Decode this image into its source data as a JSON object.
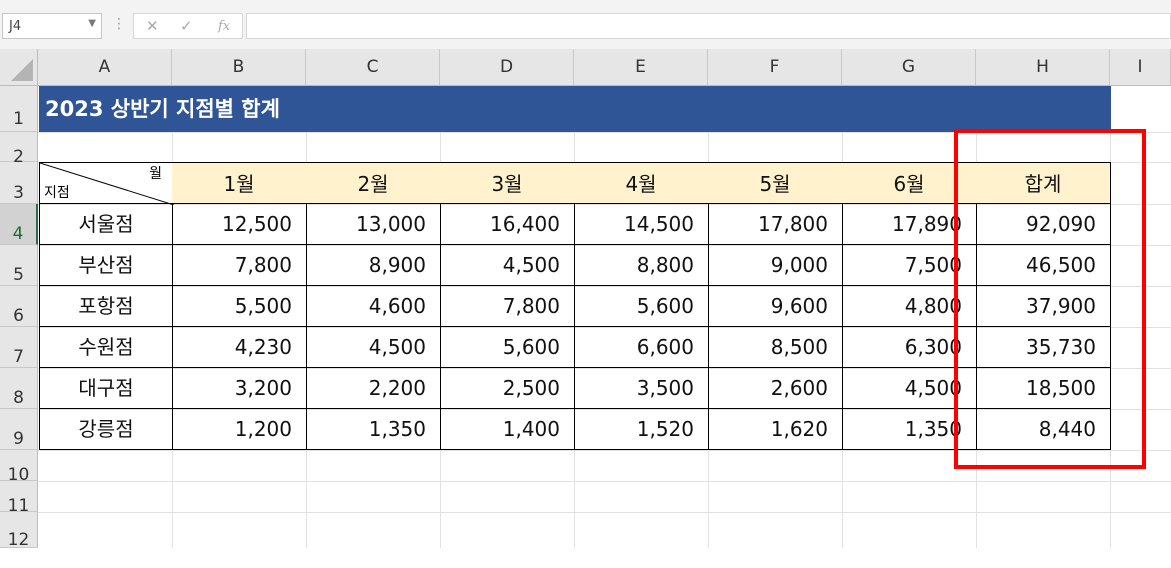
{
  "formula_bar": {
    "name_box": "J4",
    "icons": [
      "cancel-icon",
      "enter-icon",
      "function-icon"
    ],
    "formula": ""
  },
  "columns": [
    "A",
    "B",
    "C",
    "D",
    "E",
    "F",
    "G",
    "H",
    "I"
  ],
  "rows": [
    "1",
    "2",
    "3",
    "4",
    "5",
    "6",
    "7",
    "8",
    "9",
    "10",
    "11",
    "12"
  ],
  "selected_row": "4",
  "sheet": {
    "title": "2023 상반기 지점별 합계",
    "title_color": "#2f5597",
    "header_fill": "#fff2cc",
    "diag_month": "월",
    "diag_branch": "지점",
    "headers": [
      "1월",
      "2월",
      "3월",
      "4월",
      "5월",
      "6월",
      "합계"
    ],
    "data": [
      {
        "branch": "서울점",
        "values": [
          "12,500",
          "13,000",
          "16,400",
          "14,500",
          "17,800",
          "17,890",
          "92,090"
        ]
      },
      {
        "branch": "부산점",
        "values": [
          "7,800",
          "8,900",
          "4,500",
          "8,800",
          "9,000",
          "7,500",
          "46,500"
        ]
      },
      {
        "branch": "포항점",
        "values": [
          "5,500",
          "4,600",
          "7,800",
          "5,600",
          "9,600",
          "4,800",
          "37,900"
        ]
      },
      {
        "branch": "수원점",
        "values": [
          "4,230",
          "4,500",
          "5,600",
          "6,600",
          "8,500",
          "6,300",
          "35,730"
        ]
      },
      {
        "branch": "대구점",
        "values": [
          "3,200",
          "2,200",
          "2,500",
          "3,500",
          "2,600",
          "4,500",
          "18,500"
        ]
      },
      {
        "branch": "강릉점",
        "values": [
          "1,200",
          "1,350",
          "1,400",
          "1,520",
          "1,620",
          "1,350",
          "8,440"
        ]
      }
    ]
  },
  "annotation": {
    "color": "#ff0000"
  }
}
